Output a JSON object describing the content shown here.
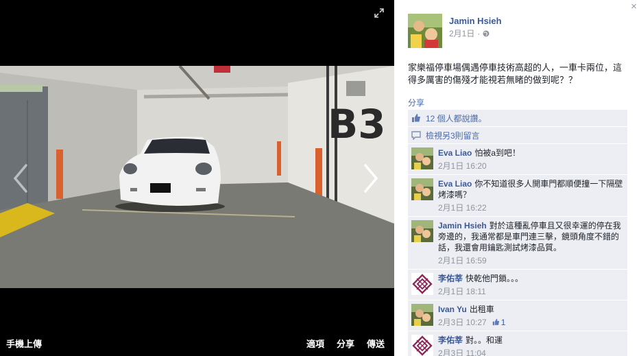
{
  "photo": {
    "bottom_left_label": "手機上傳",
    "actions": [
      "適項",
      "分享",
      "傳送"
    ],
    "level_sign": "B3"
  },
  "post": {
    "author": "Jamin Hsieh",
    "date": "2月1日",
    "separator": "·",
    "body": "家樂福停車場偶遇停車技術高超的人，一車卡兩位，這得多厲害的傷殘才能視若無睹的做到呢？？",
    "share_label": "分享",
    "likes_text": "12 個人都說讚。",
    "view_more_text": "檢視另3則留言",
    "close_label": "×"
  },
  "comments": [
    {
      "name": "Eva Liao",
      "text": "怕被a到吧！",
      "time": "2月1日 16:20",
      "likes": "",
      "avatar": "photo-avatar"
    },
    {
      "name": "Eva Liao",
      "text": "你不知道很多人開車門都順便撞一下隔壁烤漆嗎？",
      "time": "2月1日 16:22",
      "likes": "",
      "avatar": "photo-avatar"
    },
    {
      "name": "Jamin Hsieh",
      "text": "對於這種亂停車且又很幸運的停在我旁邊的，我通常都是車門連三擊，鏡頭角度不錯的話，我還會用鑰匙測試烤漆品質。",
      "time": "2月1日 16:59",
      "likes": "",
      "avatar": "photo-avatar"
    },
    {
      "name": "李佑莘",
      "text": "快乾他門鎖。。。",
      "time": "2月1日 18:11",
      "likes": "",
      "avatar": "pattern-avatar"
    },
    {
      "name": "Ivan Yu",
      "text": "出租車",
      "time": "2月3日 10:27",
      "likes": "1",
      "avatar": "photo-avatar"
    },
    {
      "name": "李佑莘",
      "text": "對。。和運",
      "time": "2月3日 11:04",
      "likes": "",
      "avatar": "pattern-avatar"
    }
  ],
  "colors": {
    "link": "#3b5998",
    "feed_bg": "#eceef3",
    "meta": "#90949c"
  }
}
